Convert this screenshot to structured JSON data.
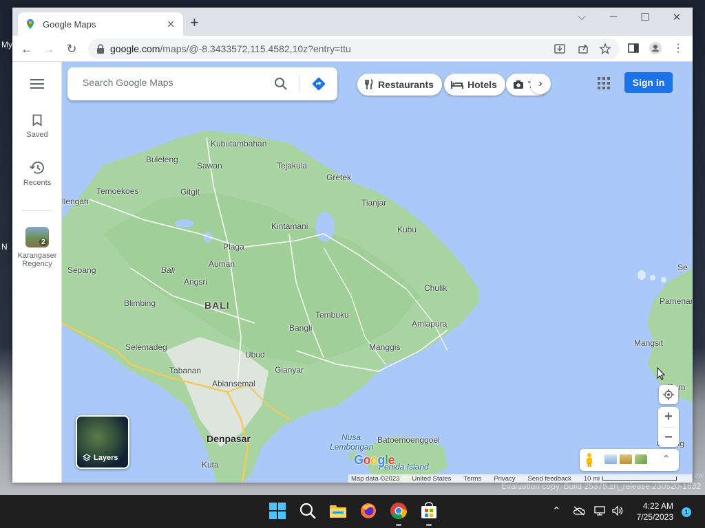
{
  "desktop": {
    "icon_label_1": "My",
    "icon_label_2": "N",
    "watermark": "Evaluation copy. Build 25375.zn_release.230520-1632",
    "watermark_edge": "ew"
  },
  "browser": {
    "tab_title": "Google Maps",
    "url_host": "google.com",
    "url_path": "/maps/@-8.3433572,115.4582,10z?entry=ttu"
  },
  "sidebar": {
    "saved_label": "Saved",
    "recents_label": "Recents",
    "place_label": "Karangaser Regency",
    "place_badge": "2"
  },
  "search": {
    "placeholder": "Search Google Maps"
  },
  "chips": {
    "restaurants": "Restaurants",
    "hotels": "Hotels",
    "things_partial": "T"
  },
  "header": {
    "signin_label": "Sign in"
  },
  "layers": {
    "label": "Layers"
  },
  "map_labels": {
    "kubutambahan": "Kubutambahan",
    "buleleng": "Buleleng",
    "sawan": "Sawan",
    "tejakula": "Tejakula",
    "gretek": "Gretek",
    "temoekoes": "Temoekoes",
    "gitgit": "Gitgit",
    "llengah": "llengah",
    "tianjar": "Tianjar",
    "kubu": "Kubu",
    "kintamani": "Kintamani",
    "plaga": "Plaga",
    "auman": "Auman",
    "sepang": "Sepang",
    "bali_small": "Bali",
    "angsri": "Angsri",
    "chulik": "Chulik",
    "blimbing": "Blimbing",
    "bali": "BALI",
    "tembuku": "Tembuku",
    "amlapura": "Amlapura",
    "bangli": "Bangli",
    "selemadeg": "Selemadeg",
    "manggis": "Manggis",
    "ubud": "Ubud",
    "tabanan": "Tabanan",
    "gianyar": "Gianyar",
    "abiansemal": "Abiansemal",
    "denpasar": "Denpasar",
    "kuta": "Kuta",
    "nusa_lembongan_1": "Nusa",
    "nusa_lembongan_2": "Lembongan",
    "batoemoenggoel": "Batoemoenggoel",
    "penida_island": "Penida Island",
    "pamenan": "Pamenan",
    "mangsit": "Mangsit",
    "senggigi_partial": "Se",
    "gerung_partial": "Gerung",
    "dam_partial": "Dam"
  },
  "footer": {
    "map_data": "Map data ©2023",
    "region": "United States",
    "terms": "Terms",
    "privacy": "Privacy",
    "feedback": "Send feedback",
    "scale": "10 mi",
    "logo": "Google"
  },
  "taskbar": {
    "time": "4:22 AM",
    "date": "7/25/2023",
    "notification_count": "1"
  }
}
